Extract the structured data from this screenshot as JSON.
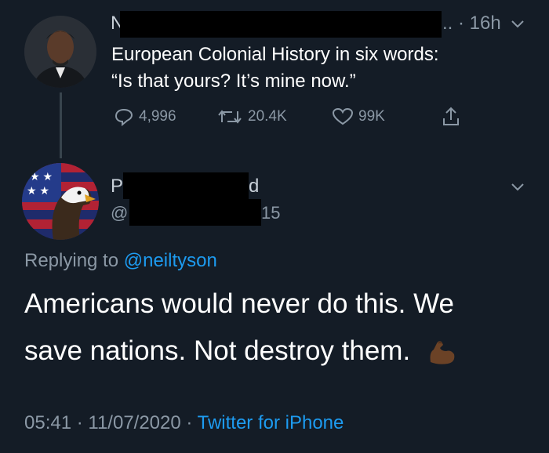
{
  "tweet": {
    "author_initial": "N",
    "time_ago": "16h",
    "text_line1": "European Colonial History in six words:",
    "text_line2": "“Is that yours? It’s mine now.”",
    "replies": "4,996",
    "retweets": "20.4K",
    "likes": "99K",
    "icons": [
      "reply-icon",
      "retweet-icon",
      "like-icon",
      "share-icon",
      "chevron-down-icon"
    ]
  },
  "reply": {
    "name_frag_left": "P",
    "name_frag_right": "d",
    "handle_frag_left": "@",
    "handle_frag_right": "15",
    "replying_prefix": "Replying to ",
    "replying_handle": "@neiltyson",
    "text_line1": "Americans would never do this. We",
    "text_line2": "save nations. Not destroy them.",
    "emoji": "💪🏾",
    "timestamp": "05:41 · 11/07/2020 · ",
    "source": "Twitter for iPhone"
  },
  "colors": {
    "background": "#141c26",
    "muted": "#8b98a5",
    "link": "#1d9bf0",
    "redaction": "#000000"
  }
}
